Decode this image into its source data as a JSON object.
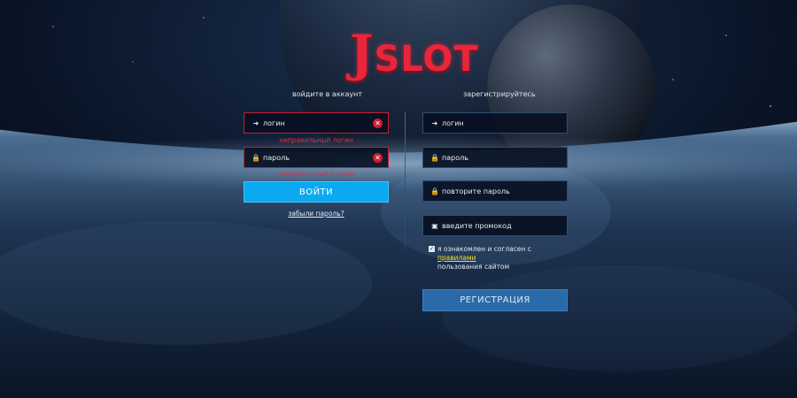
{
  "brand": {
    "logo_j": "J",
    "logo_rest": "SLOT"
  },
  "login": {
    "heading": "войдите в аккаунт",
    "login_placeholder": "логин",
    "login_error": "неправильный логин",
    "password_placeholder": "пароль",
    "password_error": "неправильный пароль",
    "submit_label": "ВОЙТИ",
    "forgot_label": "забыли пароль?"
  },
  "register": {
    "heading": "зарегистрируйтесь",
    "login_placeholder": "логин",
    "password_placeholder": "пароль",
    "repeat_password_placeholder": "повторите пароль",
    "promo_placeholder": "введите промокод",
    "agree_prefix": "я ознакомлен и согласен с",
    "agree_link": "правилами",
    "agree_suffix": "пользования сайтом",
    "agree_checked": true,
    "submit_label": "РЕГИСТРАЦИЯ"
  },
  "icons": {
    "login": "sign-in-icon",
    "password": "lock-icon",
    "promo": "gift-icon",
    "clear": "close-circle-icon",
    "checkbox": "checkmark-icon"
  },
  "colors": {
    "accent_login": "#0aa9f0",
    "accent_register": "#2a6aa8",
    "error": "#d21a2f",
    "logo": "#e8253a",
    "link": "#f2e21c"
  }
}
